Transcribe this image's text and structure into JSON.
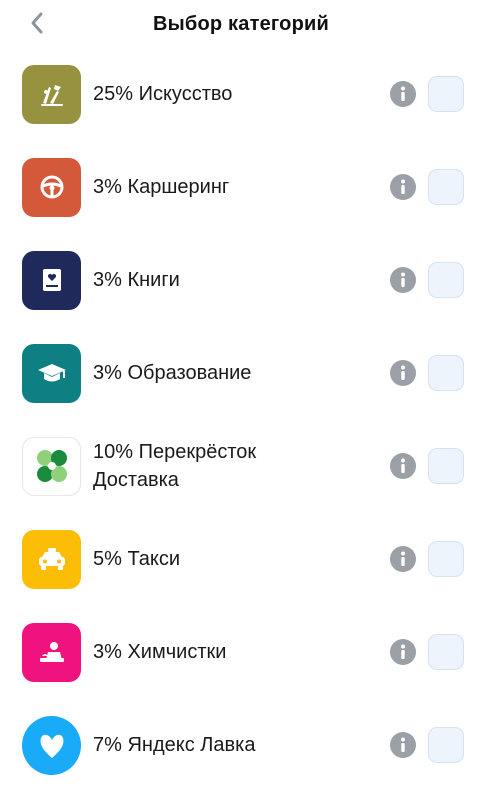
{
  "header": {
    "title": "Выбор категорий"
  },
  "categories": [
    {
      "label": "25% Искусство",
      "icon": "art-icon",
      "color": "#97923f"
    },
    {
      "label": "3% Каршеринг",
      "icon": "steering-wheel-icon",
      "color": "#d4583a"
    },
    {
      "label": "3% Книги",
      "icon": "book-icon",
      "color": "#1f2a5a"
    },
    {
      "label": "3% Образование",
      "icon": "graduation-cap-icon",
      "color": "#0e7f83"
    },
    {
      "label": "10% Перекрёсток Доставка",
      "icon": "perekrestok-logo-icon",
      "color": "#ffffff"
    },
    {
      "label": "5% Такси",
      "icon": "taxi-icon",
      "color": "#fbbd05"
    },
    {
      "label": "3% Химчистки",
      "icon": "dry-cleaning-icon",
      "color": "#f0127e"
    },
    {
      "label": "7% Яндекс Лавка",
      "icon": "yandex-lavka-logo-icon",
      "color": "#19aaf8"
    }
  ]
}
